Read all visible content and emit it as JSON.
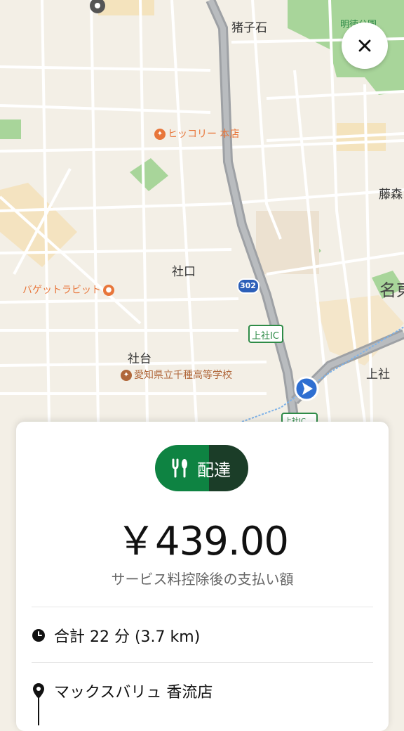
{
  "map": {
    "labels": {
      "inokoishi": "猪子石",
      "meitoku_park": "明徳公園",
      "hickory": "ヒッコリー 本店",
      "fujimori": "藤森",
      "shakuchi": "社口",
      "baguette_rabbit": "バゲットラビット",
      "route_302": "302",
      "kamiyashiro_ic": "上社IC",
      "kamiyashiro_ic_2": "上社IC",
      "meito_partial": "名東",
      "kamiyashiro": "上社",
      "yashirodai": "社台",
      "chikusa_high": "愛知県立千種高等学校"
    }
  },
  "close_button": {
    "icon": "close-icon"
  },
  "order": {
    "type_label": "配達",
    "type_icon": "utensils-icon",
    "amount": "￥439.00",
    "amount_note": "サービス料控除後の支払い額",
    "total_time": "合計 22 分 (3.7 km)",
    "pickup_name": "マックスバリュ 香流店"
  },
  "colors": {
    "accent_green": "#0e8342",
    "dark_green": "#1b3d28",
    "poi_orange": "#e8763a",
    "route_blue": "#3a7ad0",
    "highway_gray": "#a7aaad"
  }
}
